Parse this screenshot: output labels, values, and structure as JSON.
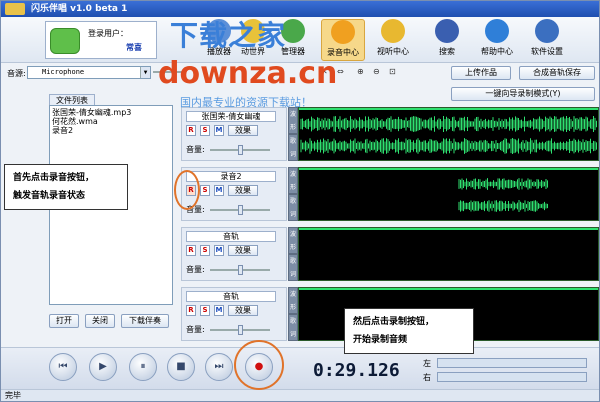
{
  "window": {
    "title": "闪乐伴唱 v1.0 beta 1"
  },
  "user": {
    "label": "登录用户：",
    "name": "常喜"
  },
  "toolbar": {
    "items": [
      {
        "label": "播放器",
        "icon": "player-icon"
      },
      {
        "label": "动世界",
        "icon": "star-icon"
      },
      {
        "label": "管理器",
        "icon": "manager-icon"
      },
      {
        "label": "录音中心",
        "icon": "mic-smiley-icon",
        "active": true
      },
      {
        "label": "视听中心",
        "icon": "disc-icon"
      },
      {
        "label": "搜索",
        "icon": "search-icon"
      },
      {
        "label": "帮助中心",
        "icon": "help-icon"
      },
      {
        "label": "软件设置",
        "icon": "settings-icon"
      }
    ]
  },
  "source": {
    "label": "音源:",
    "value": "Microphone"
  },
  "buttons": {
    "upload": "上传作品",
    "merge_save": "合成音轨保存",
    "wizard": "一键向导录制模式(Y)"
  },
  "file_list": {
    "title": "文件列表",
    "items": [
      "张国荣-倩女幽魂.mp3",
      "何花然.wma",
      "录音2"
    ],
    "open": "打开",
    "close": "关闭",
    "download": "下载伴奏"
  },
  "tracks": [
    {
      "name": "张国荣-倩女幽魂",
      "effect": "效果",
      "volume": "音量:",
      "tabs": [
        "波形",
        "歌词"
      ]
    },
    {
      "name": "录音2",
      "effect": "效果",
      "volume": "音量:",
      "tabs": [
        "波形",
        "歌词"
      ]
    },
    {
      "name": "音轨",
      "effect": "效果",
      "volume": "音量:",
      "tabs": [
        "波形",
        "歌词"
      ]
    },
    {
      "name": "音轨",
      "effect": "效果",
      "volume": "音量:",
      "tabs": [
        "波形",
        "歌词"
      ]
    }
  ],
  "track_btns": {
    "r": "R",
    "s": "S",
    "m": "M"
  },
  "player": {
    "time": "0:29.126",
    "left": "左",
    "right": "右"
  },
  "status": {
    "text": "完毕"
  },
  "callouts": {
    "first_line1": "首先点击录音按钮，",
    "first_line2": "触发音轨录音状态",
    "then_line1": "然后点击录制按钮，",
    "then_line2": "开始录制音频"
  },
  "watermark": {
    "cn": "下载之家",
    "url": "downza.cn",
    "slogan": "国内最专业的资源下载站！"
  },
  "colors": {
    "accent": "#e0732a",
    "wave": "#2fe070",
    "title_bar": "#1f4fb0"
  }
}
